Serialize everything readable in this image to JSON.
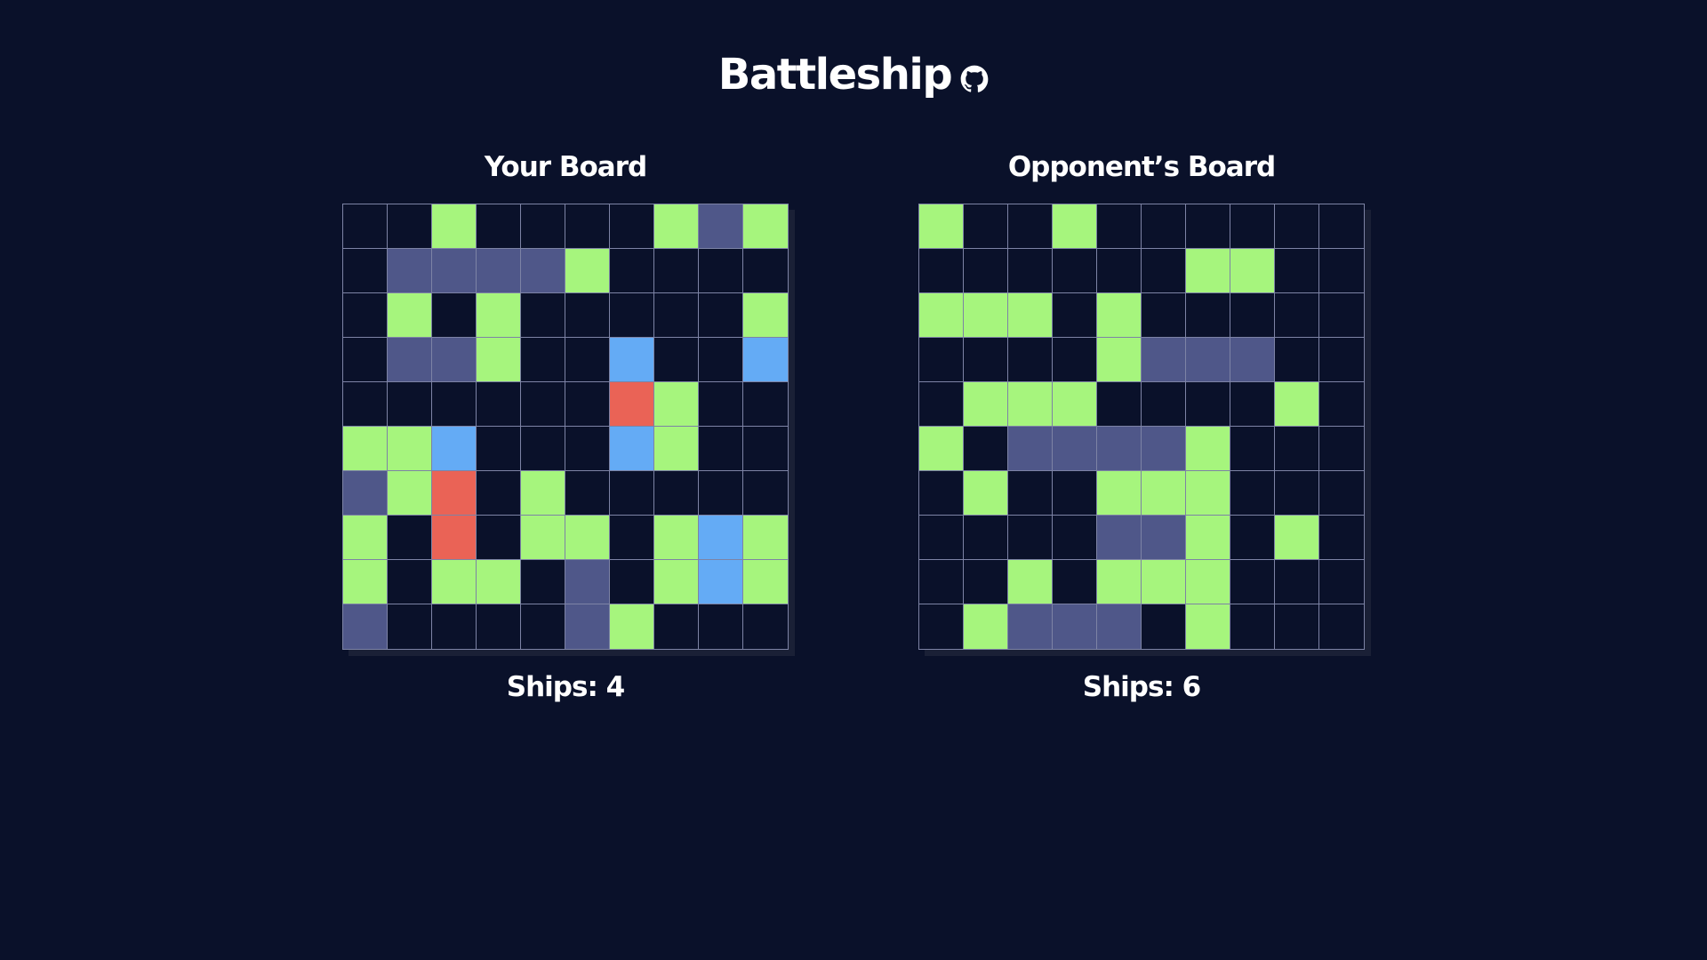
{
  "title": "Battleship",
  "colors": {
    "background": "#0a112a",
    "empty": "#0a112a",
    "miss": "#a6f57d",
    "ship": "#4f5789",
    "hit": "#ea6356",
    "ship_blue": "#64abf5",
    "grid_line": "#7d83a5"
  },
  "legend_codes": {
    "0": "empty",
    "1": "miss",
    "2": "ship",
    "3": "hit",
    "4": "ship_blue"
  },
  "player_board": {
    "title": "Your Board",
    "ships_label": "Ships: 4",
    "cells": [
      [
        0,
        0,
        1,
        0,
        0,
        0,
        0,
        1,
        2,
        1
      ],
      [
        0,
        2,
        2,
        2,
        2,
        1,
        0,
        0,
        0,
        0
      ],
      [
        0,
        1,
        0,
        1,
        0,
        0,
        0,
        0,
        0,
        1
      ],
      [
        0,
        2,
        2,
        1,
        0,
        0,
        4,
        0,
        0,
        4
      ],
      [
        0,
        0,
        0,
        0,
        0,
        0,
        3,
        1,
        0,
        0
      ],
      [
        1,
        1,
        4,
        0,
        0,
        0,
        4,
        1,
        0,
        0
      ],
      [
        2,
        1,
        3,
        0,
        1,
        0,
        0,
        0,
        0,
        0
      ],
      [
        1,
        0,
        3,
        0,
        1,
        1,
        0,
        1,
        4,
        1
      ],
      [
        1,
        0,
        1,
        1,
        0,
        2,
        0,
        1,
        4,
        1
      ],
      [
        2,
        0,
        0,
        0,
        0,
        2,
        1,
        0,
        0,
        0
      ]
    ]
  },
  "opponent_board": {
    "title": "Opponent’s Board",
    "ships_label": "Ships: 6",
    "cells": [
      [
        1,
        0,
        0,
        1,
        0,
        0,
        0,
        0,
        0,
        0
      ],
      [
        0,
        0,
        0,
        0,
        0,
        0,
        1,
        1,
        0,
        0
      ],
      [
        1,
        1,
        1,
        0,
        1,
        0,
        0,
        0,
        0,
        0
      ],
      [
        0,
        0,
        0,
        0,
        1,
        2,
        2,
        2,
        0,
        0
      ],
      [
        0,
        1,
        1,
        1,
        0,
        0,
        0,
        0,
        1,
        0
      ],
      [
        1,
        0,
        2,
        2,
        2,
        2,
        1,
        0,
        0,
        0
      ],
      [
        0,
        1,
        0,
        0,
        1,
        1,
        1,
        0,
        0,
        0
      ],
      [
        0,
        0,
        0,
        0,
        2,
        2,
        1,
        0,
        1,
        0
      ],
      [
        0,
        0,
        1,
        0,
        1,
        1,
        1,
        0,
        0,
        0
      ],
      [
        0,
        1,
        2,
        2,
        2,
        0,
        1,
        0,
        0,
        0
      ]
    ]
  }
}
